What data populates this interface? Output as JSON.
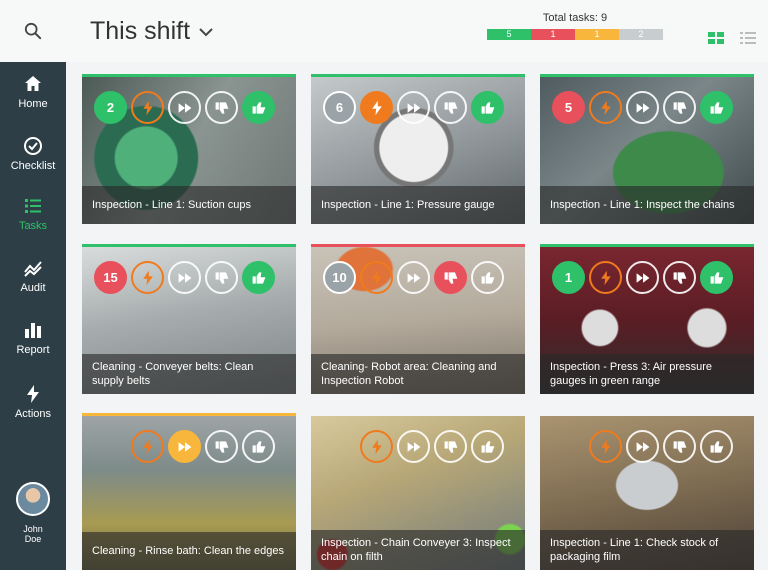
{
  "header": {
    "title": "This shift",
    "total_label": "Total tasks: 9",
    "counts": [
      {
        "value": "5",
        "color": "#2ec16a"
      },
      {
        "value": "1",
        "color": "#e8505b"
      },
      {
        "value": "1",
        "color": "#f8b63c"
      },
      {
        "value": "2",
        "color": "#c8cdd0"
      }
    ]
  },
  "nav": {
    "home": "Home",
    "checklist": "Checklist",
    "tasks": "Tasks",
    "audit": "Audit",
    "report": "Report",
    "actions": "Actions"
  },
  "user": {
    "name": "John\nDoe"
  },
  "cards": [
    {
      "caption": "Inspection - Line 1: Suction cups",
      "count": "2",
      "top": "#2ec16a"
    },
    {
      "caption": "Inspection - Line 1: Pressure gauge",
      "count": "6",
      "top": "#2ec16a"
    },
    {
      "caption": "Inspection - Line 1: Inspect the chains",
      "count": "5",
      "top": "#2ec16a"
    },
    {
      "caption": "Cleaning - Conveyer belts: Clean supply belts",
      "count": "15",
      "top": "#2ec16a"
    },
    {
      "caption": "Cleaning- Robot area: Cleaning and Inspection Robot",
      "count": "10",
      "top": "#e8505b"
    },
    {
      "caption": "Inspection - Press 3: Air pressure gauges in green range",
      "count": "1",
      "top": "#2ec16a"
    },
    {
      "caption": "Cleaning - Rinse bath: Clean the edges",
      "count": "",
      "top": "#f8b63c"
    },
    {
      "caption": "Inspection - Chain Conveyer 3: Inspect chain on filth",
      "count": "",
      "top": "transparent"
    },
    {
      "caption": "Inspection - Line 1: Check stock of packaging film",
      "count": "",
      "top": "transparent"
    }
  ]
}
